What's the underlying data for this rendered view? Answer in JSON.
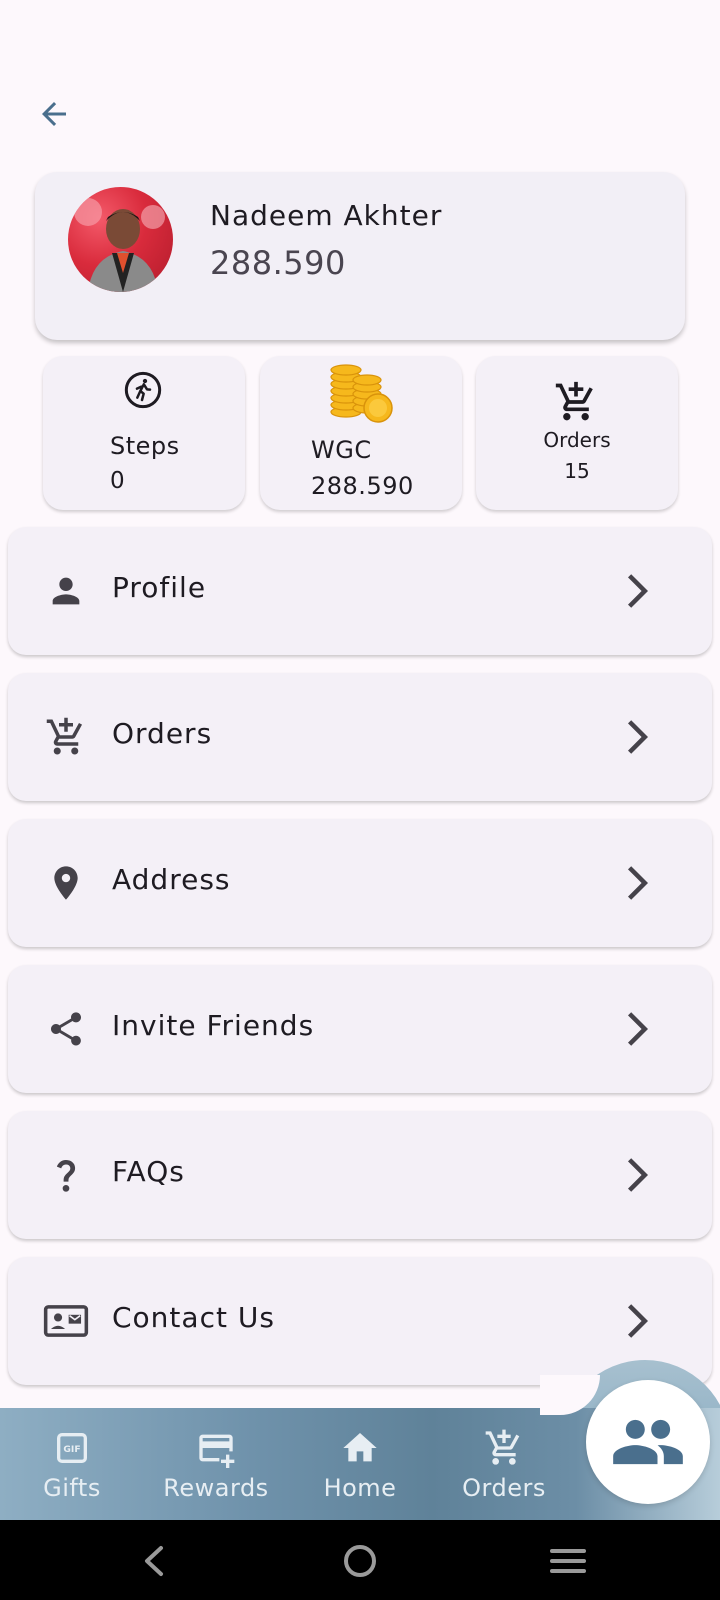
{
  "header": {
    "back_icon": "arrow-back-icon"
  },
  "profile": {
    "name": "Nadeem Akhter",
    "balance": "288.590",
    "avatar_icon": "user-photo"
  },
  "stats": {
    "steps": {
      "label": "Steps",
      "value": "0",
      "icon": "walking-person-icon"
    },
    "wgc": {
      "label": "WGC",
      "value": "288.590",
      "icon": "gold-coins-icon"
    },
    "orders": {
      "label": "Orders",
      "value": "15",
      "icon": "cart-add-icon"
    }
  },
  "menu": [
    {
      "label": "Profile",
      "icon": "person-icon"
    },
    {
      "label": "Orders",
      "icon": "cart-add-icon"
    },
    {
      "label": "Address",
      "icon": "location-pin-icon"
    },
    {
      "label": "Invite Friends",
      "icon": "share-icon"
    },
    {
      "label": "FAQs",
      "icon": "question-icon"
    },
    {
      "label": "Contact Us",
      "icon": "contact-card-icon"
    }
  ],
  "bottom_nav": {
    "items": [
      {
        "label": "Gifts",
        "icon": "gif-icon"
      },
      {
        "label": "Rewards",
        "icon": "card-add-icon"
      },
      {
        "label": "Home",
        "icon": "home-icon"
      },
      {
        "label": "Orders",
        "icon": "cart-add-icon"
      }
    ],
    "active": {
      "icon": "group-icon"
    }
  },
  "colors": {
    "background": "#fdf8fc",
    "card": "#f2eff6",
    "accent": "#4a6f8d",
    "icon_dark": "#45424a"
  }
}
